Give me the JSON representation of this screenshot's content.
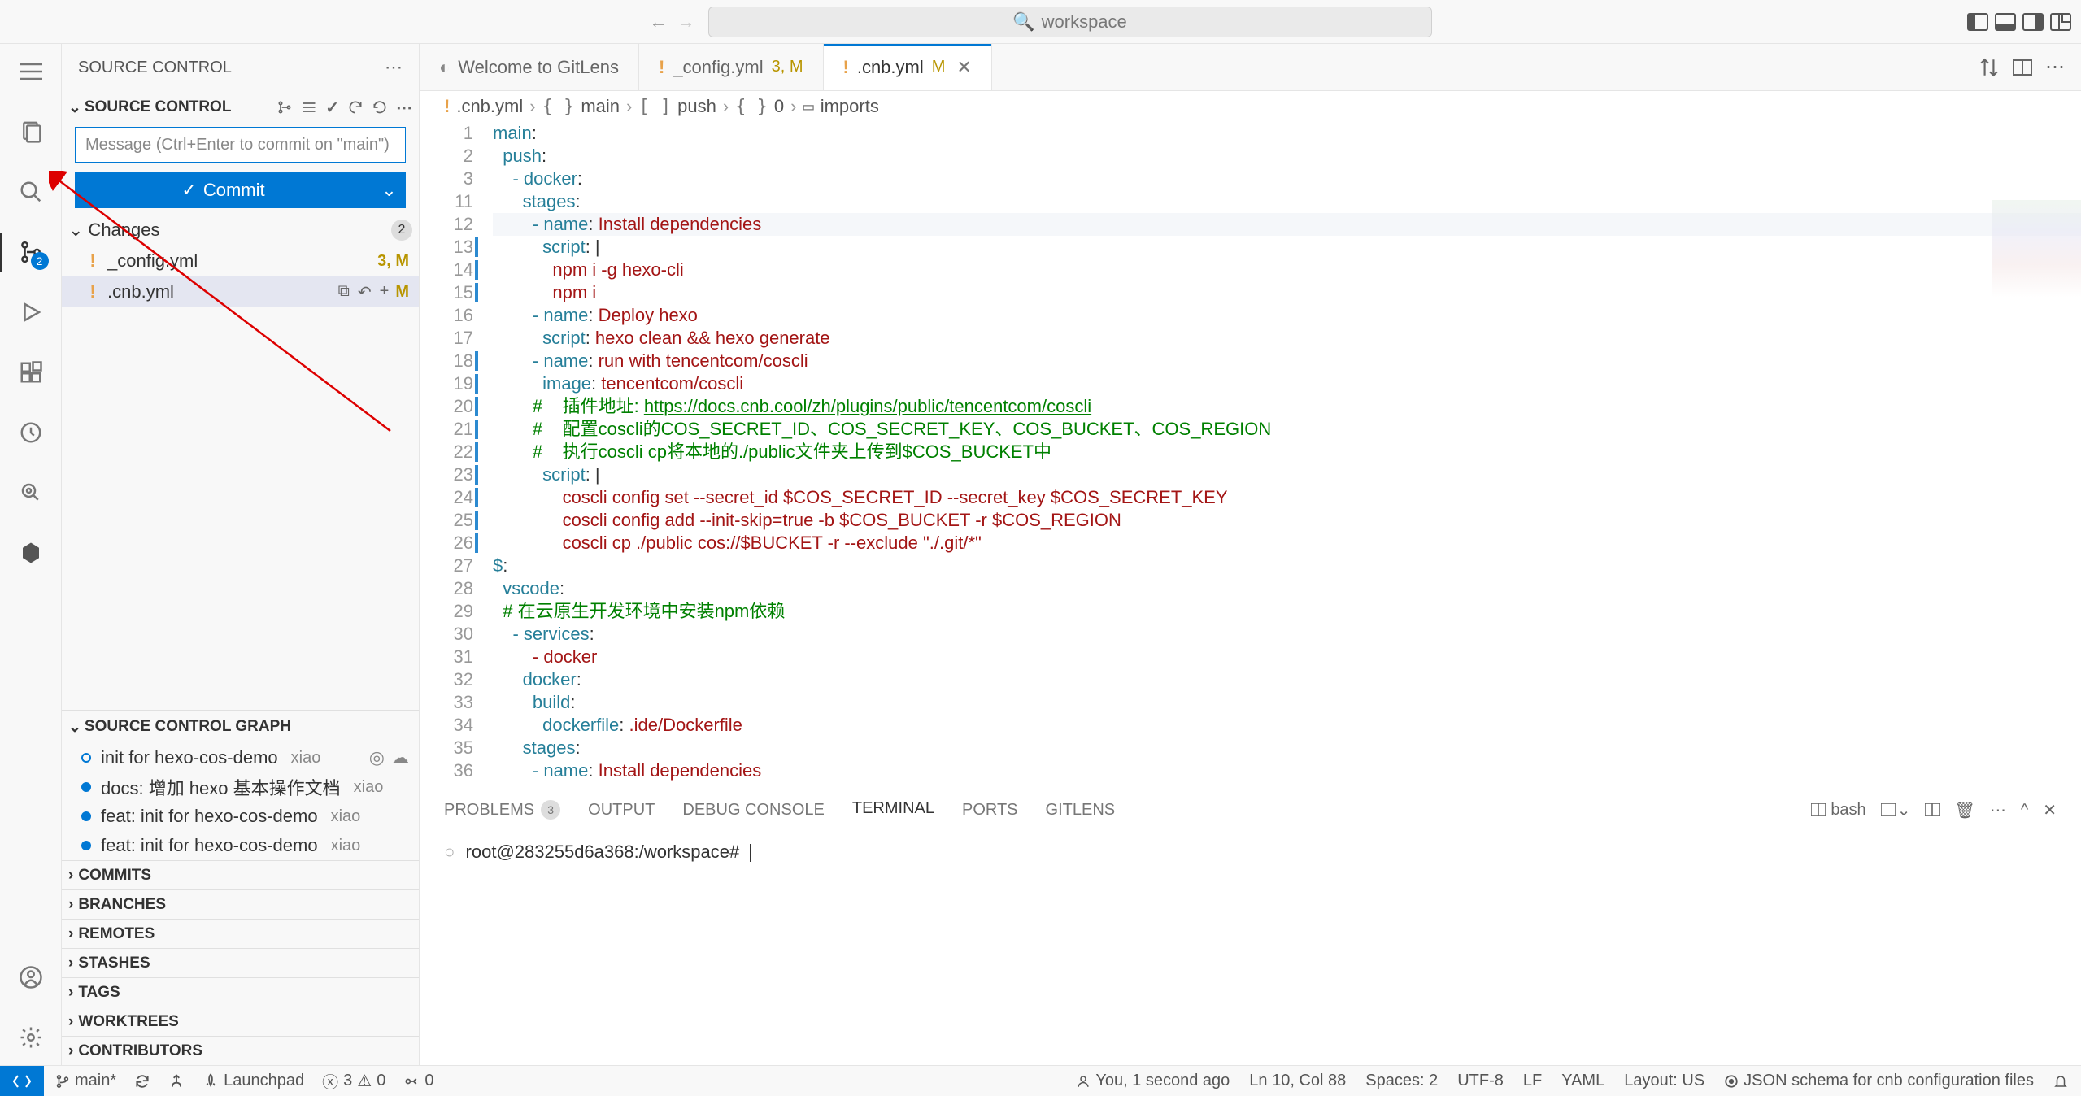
{
  "title_bar": {
    "search_placeholder": "workspace"
  },
  "activity_bar": {
    "scm_badge": "2"
  },
  "sidebar": {
    "title": "SOURCE CONTROL",
    "scm_section": "SOURCE CONTROL",
    "commit_placeholder": "Message (Ctrl+Enter to commit on \"main\")",
    "commit_button": "Commit",
    "changes_label": "Changes",
    "changes_count": "2",
    "files": [
      {
        "name": "_config.yml",
        "status": "3, M"
      },
      {
        "name": ".cnb.yml",
        "status": "M"
      }
    ],
    "graph_title": "SOURCE CONTROL GRAPH",
    "graph_items": [
      {
        "msg": "init for hexo-cos-demo",
        "author": "xiao",
        "dot": "outline",
        "actions": true
      },
      {
        "msg": "docs: 增加 hexo 基本操作文档",
        "author": "xiao",
        "dot": "fill"
      },
      {
        "msg": "feat: init for hexo-cos-demo",
        "author": "xiao",
        "dot": "fill"
      },
      {
        "msg": "feat: init for hexo-cos-demo",
        "author": "xiao",
        "dot": "fill"
      }
    ],
    "sections": [
      "COMMITS",
      "BRANCHES",
      "REMOTES",
      "STASHES",
      "TAGS",
      "WORKTREES",
      "CONTRIBUTORS"
    ]
  },
  "tabs": [
    {
      "label": "Welcome to GitLens",
      "icon": "gitlens",
      "stat": "",
      "active": false
    },
    {
      "label": "_config.yml",
      "icon": "warn",
      "stat": "3, M",
      "active": false
    },
    {
      "label": ".cnb.yml",
      "icon": "warn",
      "stat": "M",
      "active": true
    }
  ],
  "breadcrumb": {
    "file": ".cnb.yml",
    "parts": [
      "main",
      "push",
      "0",
      "imports"
    ]
  },
  "code": {
    "start": 1,
    "lines": [
      {
        "n": 1,
        "mod": false,
        "segs": [
          [
            "main",
            "key"
          ],
          [
            ":",
            "plain"
          ]
        ]
      },
      {
        "n": 2,
        "mod": false,
        "segs": [
          [
            "  push",
            "key"
          ],
          [
            ":",
            "plain"
          ]
        ]
      },
      {
        "n": 3,
        "mod": false,
        "segs": [
          [
            "    - docker",
            "key"
          ],
          [
            ":",
            "plain"
          ]
        ]
      },
      {
        "n": 11,
        "mod": false,
        "segs": [
          [
            "      stages",
            "key"
          ],
          [
            ":",
            "plain"
          ]
        ]
      },
      {
        "n": 12,
        "mod": false,
        "hl": true,
        "segs": [
          [
            "        - name",
            "key"
          ],
          [
            ": ",
            "plain"
          ],
          [
            "Install dependencies",
            "str"
          ]
        ]
      },
      {
        "n": 13,
        "mod": true,
        "segs": [
          [
            "          script",
            "key"
          ],
          [
            ": |",
            "plain"
          ]
        ]
      },
      {
        "n": 14,
        "mod": true,
        "segs": [
          [
            "            npm i -g hexo-cli",
            "str"
          ]
        ]
      },
      {
        "n": 15,
        "mod": true,
        "segs": [
          [
            "            npm i",
            "str"
          ]
        ]
      },
      {
        "n": 16,
        "mod": false,
        "segs": [
          [
            "        - name",
            "key"
          ],
          [
            ": ",
            "plain"
          ],
          [
            "Deploy hexo",
            "str"
          ]
        ]
      },
      {
        "n": 17,
        "mod": false,
        "segs": [
          [
            "          script",
            "key"
          ],
          [
            ": ",
            "plain"
          ],
          [
            "hexo clean && hexo generate",
            "str"
          ]
        ]
      },
      {
        "n": 18,
        "mod": true,
        "segs": [
          [
            "        - name",
            "key"
          ],
          [
            ": ",
            "plain"
          ],
          [
            "run with tencentcom/coscli",
            "str"
          ]
        ]
      },
      {
        "n": 19,
        "mod": true,
        "segs": [
          [
            "          image",
            "key"
          ],
          [
            ": ",
            "plain"
          ],
          [
            "tencentcom/coscli",
            "str"
          ]
        ]
      },
      {
        "n": 20,
        "mod": true,
        "segs": [
          [
            "        #    插件地址: ",
            "cmt"
          ],
          [
            "https://docs.cnb.cool/zh/plugins/public/tencentcom/coscli",
            "link"
          ]
        ]
      },
      {
        "n": 21,
        "mod": true,
        "segs": [
          [
            "        #    配置coscli的COS_SECRET_ID、COS_SECRET_KEY、COS_BUCKET、COS_REGION",
            "cmt"
          ]
        ]
      },
      {
        "n": 22,
        "mod": true,
        "segs": [
          [
            "        #    执行coscli cp将本地的./public文件夹上传到$COS_BUCKET中",
            "cmt"
          ]
        ]
      },
      {
        "n": 23,
        "mod": true,
        "segs": [
          [
            "          script",
            "key"
          ],
          [
            ": |",
            "plain"
          ]
        ]
      },
      {
        "n": 24,
        "mod": true,
        "segs": [
          [
            "              coscli config set --secret_id $COS_SECRET_ID --secret_key $COS_SECRET_KEY",
            "str"
          ]
        ]
      },
      {
        "n": 25,
        "mod": true,
        "segs": [
          [
            "              coscli config add --init-skip=true -b $COS_BUCKET -r $COS_REGION",
            "str"
          ]
        ]
      },
      {
        "n": 26,
        "mod": true,
        "segs": [
          [
            "              coscli cp ./public cos://$BUCKET -r --exclude \"./.git/*\"",
            "str"
          ]
        ]
      },
      {
        "n": 27,
        "mod": false,
        "segs": [
          [
            "$",
            "key"
          ],
          [
            ":",
            "plain"
          ]
        ]
      },
      {
        "n": 28,
        "mod": false,
        "segs": [
          [
            "  vscode",
            "key"
          ],
          [
            ":",
            "plain"
          ]
        ]
      },
      {
        "n": 29,
        "mod": false,
        "segs": [
          [
            "  # 在云原生开发环境中安装npm依赖",
            "cmt"
          ]
        ]
      },
      {
        "n": 30,
        "mod": false,
        "segs": [
          [
            "    - services",
            "key"
          ],
          [
            ":",
            "plain"
          ]
        ]
      },
      {
        "n": 31,
        "mod": false,
        "segs": [
          [
            "        - docker",
            "str"
          ]
        ]
      },
      {
        "n": 32,
        "mod": false,
        "segs": [
          [
            "      docker",
            "key"
          ],
          [
            ":",
            "plain"
          ]
        ]
      },
      {
        "n": 33,
        "mod": false,
        "segs": [
          [
            "        build",
            "key"
          ],
          [
            ":",
            "plain"
          ]
        ]
      },
      {
        "n": 34,
        "mod": false,
        "segs": [
          [
            "          dockerfile",
            "key"
          ],
          [
            ": ",
            "plain"
          ],
          [
            ".ide/Dockerfile",
            "str"
          ]
        ]
      },
      {
        "n": 35,
        "mod": false,
        "segs": [
          [
            "      stages",
            "key"
          ],
          [
            ":",
            "plain"
          ]
        ]
      },
      {
        "n": 36,
        "mod": false,
        "segs": [
          [
            "        - name",
            "key"
          ],
          [
            ": ",
            "plain"
          ],
          [
            "Install dependencies",
            "str"
          ]
        ]
      }
    ]
  },
  "panel": {
    "tabs": {
      "problems": "PROBLEMS",
      "problems_count": "3",
      "output": "OUTPUT",
      "debug": "DEBUG CONSOLE",
      "terminal": "TERMINAL",
      "ports": "PORTS",
      "gitlens": "GITLENS"
    },
    "terminal_label": "bash",
    "prompt": "root@283255d6a368:/workspace#"
  },
  "status": {
    "branch": "main*",
    "launchpad": "Launchpad",
    "diag": {
      "err": "3",
      "warn": "0"
    },
    "ports": "0",
    "blame": "You, 1 second ago",
    "pos": "Ln 10, Col 88",
    "spaces": "Spaces: 2",
    "encoding": "UTF-8",
    "eol": "LF",
    "lang": "YAML",
    "layout": "Layout: US",
    "schema": "JSON schema for cnb configuration files"
  }
}
